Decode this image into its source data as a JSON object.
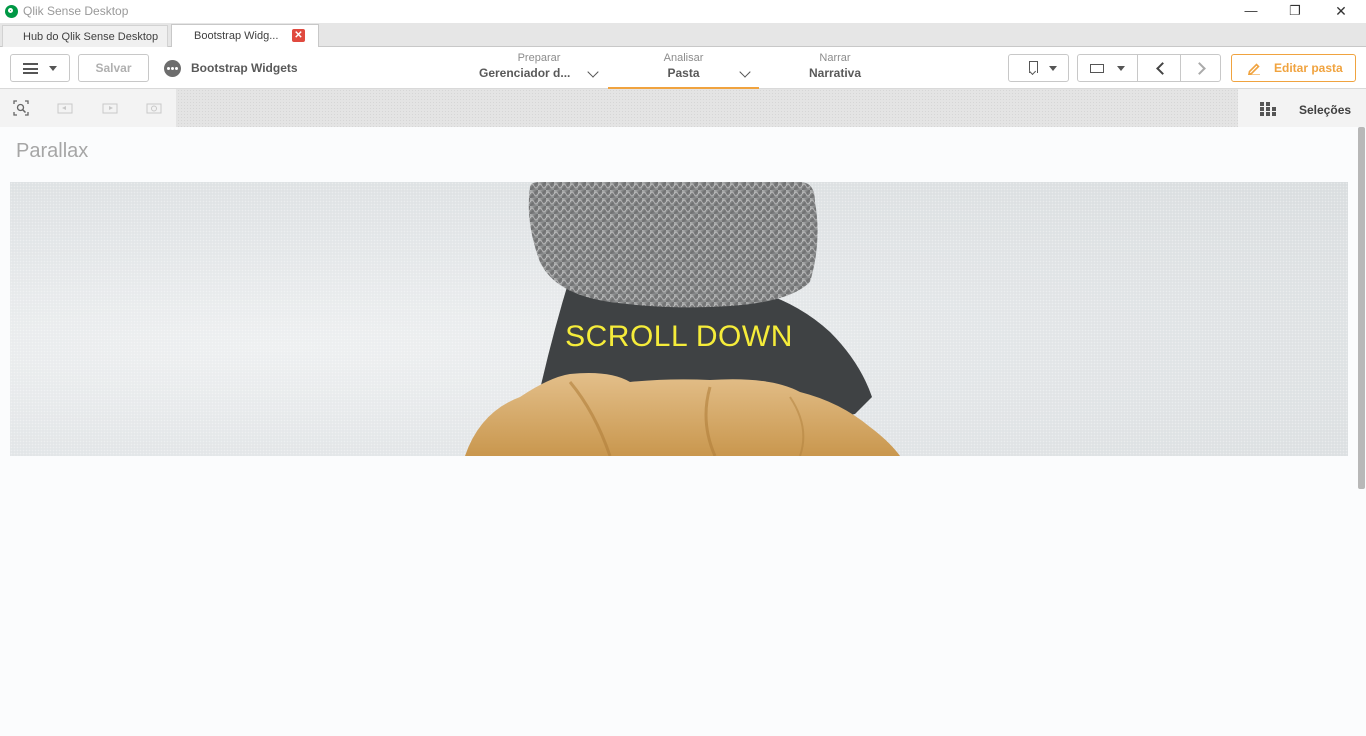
{
  "window": {
    "title": "Qlik Sense Desktop",
    "min_glyph": "—",
    "max_glyph": "❐",
    "close_glyph": "✕"
  },
  "tabs": [
    {
      "label": "Hub do Qlik Sense Desktop",
      "active": false
    },
    {
      "label": "Bootstrap Widg...",
      "active": true,
      "close_glyph": "✕"
    }
  ],
  "toolbar": {
    "save_label": "Salvar",
    "app_name": "Bootstrap Widgets",
    "nav": {
      "prepare": {
        "small": "Preparar",
        "big": "Gerenciador d..."
      },
      "analyze": {
        "small": "Analisar",
        "big": "Pasta"
      },
      "narrate": {
        "small": "Narrar",
        "big": "Narrativa"
      }
    },
    "edit_label": "Editar pasta",
    "accent_color": "#f0a33f"
  },
  "selections": {
    "label": "Seleções",
    "tools": [
      "smart-search-icon",
      "step-back-icon",
      "step-forward-icon",
      "clear-selections-icon"
    ]
  },
  "sheet": {
    "title": "Parallax",
    "hero_text": "SCROLL DOWN",
    "hero_text_color": "#f5ec3a"
  }
}
